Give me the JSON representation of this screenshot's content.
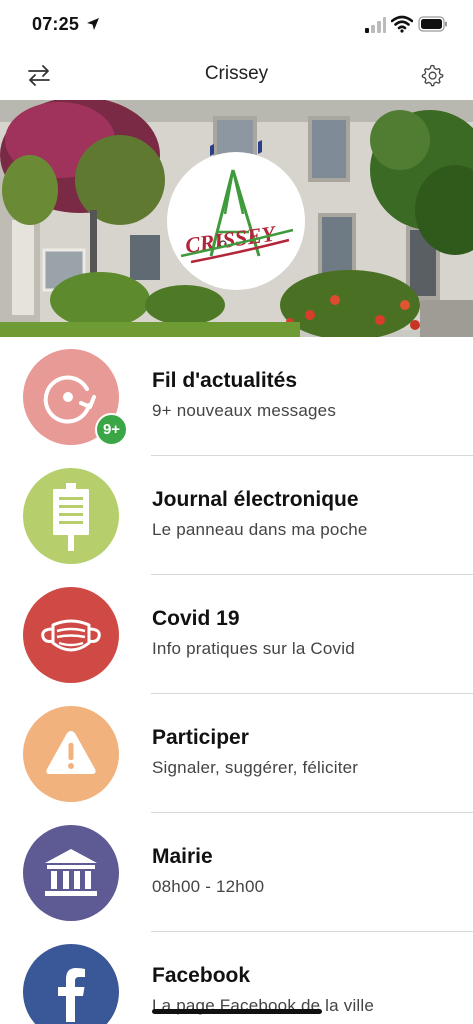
{
  "status_bar": {
    "time": "07:25"
  },
  "nav": {
    "title": "Crissey",
    "left_icon": "swap-arrows-icon",
    "right_icon": "gear-icon"
  },
  "hero": {
    "logo_text": "CRISSEY"
  },
  "menu": [
    {
      "title": "Fil d'actualités",
      "subtitle": "9+ nouveaux messages",
      "color": "#e89a96",
      "icon": "refresh-icon",
      "badge": "9+"
    },
    {
      "title": "Journal électronique",
      "subtitle": "Le panneau dans ma poche",
      "color": "#b6cf6c",
      "icon": "sign-board-icon"
    },
    {
      "title": "Covid 19",
      "subtitle": "Info pratiques sur la Covid",
      "color": "#cf4a45",
      "icon": "face-mask-icon"
    },
    {
      "title": "Participer",
      "subtitle": "Signaler, suggérer, féliciter",
      "color": "#f2b27e",
      "icon": "warning-icon"
    },
    {
      "title": "Mairie",
      "subtitle": "08h00 - 12h00",
      "color": "#5e5a94",
      "icon": "town-hall-icon"
    },
    {
      "title": "Facebook",
      "subtitle": "La page Facebook de la ville",
      "color": "#3a5797",
      "icon": "facebook-icon"
    }
  ],
  "colors": {
    "badge": "#3aa645",
    "divider": "#d8d8d8"
  }
}
